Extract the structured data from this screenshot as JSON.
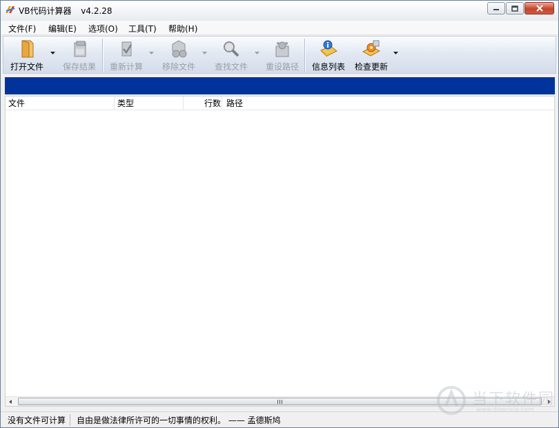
{
  "window": {
    "app_name": "VB代码计算器",
    "version": "v4.2.28"
  },
  "menu": [
    {
      "label": "文件(F)"
    },
    {
      "label": "编辑(E)"
    },
    {
      "label": "选项(O)"
    },
    {
      "label": "工具(T)"
    },
    {
      "label": "帮助(H)"
    }
  ],
  "toolbar": {
    "open_file": "打开文件",
    "save_result": "保存结果",
    "recalc": "重新计算",
    "remove_file": "移除文件",
    "find_file": "查找文件",
    "reset_path": "重设路径",
    "info_list": "信息列表",
    "check_update": "检查更新"
  },
  "list": {
    "columns": [
      "文件",
      "类型",
      "",
      "行数",
      "路径"
    ]
  },
  "status": {
    "left": "没有文件可计算",
    "quote": "自由是做法律所许可的一切事情的权利。 ——  孟德斯鸠"
  },
  "watermark": {
    "title": "当下软件园",
    "url": "www.downxia.com"
  },
  "colors": {
    "accent_band": "#00349c",
    "close_button": "#c7442c"
  }
}
